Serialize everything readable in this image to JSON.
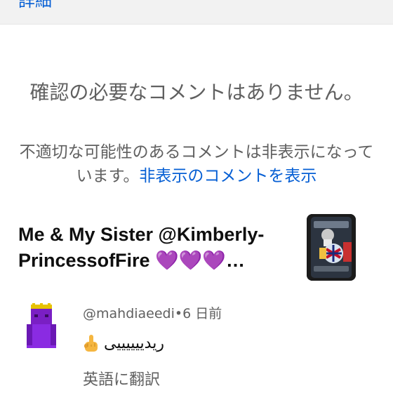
{
  "top_banner": {
    "details_link": "詳細"
  },
  "empty_state": {
    "title": "確認の必要なコメントはありません。",
    "description": "不適切な可能性のあるコメントは非表示になっています。",
    "show_hidden_link": "非表示のコメントを表示"
  },
  "video": {
    "title_text": "Me & My Sister @Kimberly-PrincessofFire ",
    "title_emoji": "💜💜💜",
    "title_ellipsis": "…"
  },
  "comment": {
    "author": "@mahdiaeedi",
    "separator": "•",
    "time_ago": "6 日前",
    "text": "ریدییییییی",
    "translate_label": "英語に翻訳"
  },
  "colors": {
    "link": "#065fd4",
    "secondary_text": "#606060",
    "banner_bg": "#f2f2f2",
    "avatar_purple": "#8a2be2"
  }
}
